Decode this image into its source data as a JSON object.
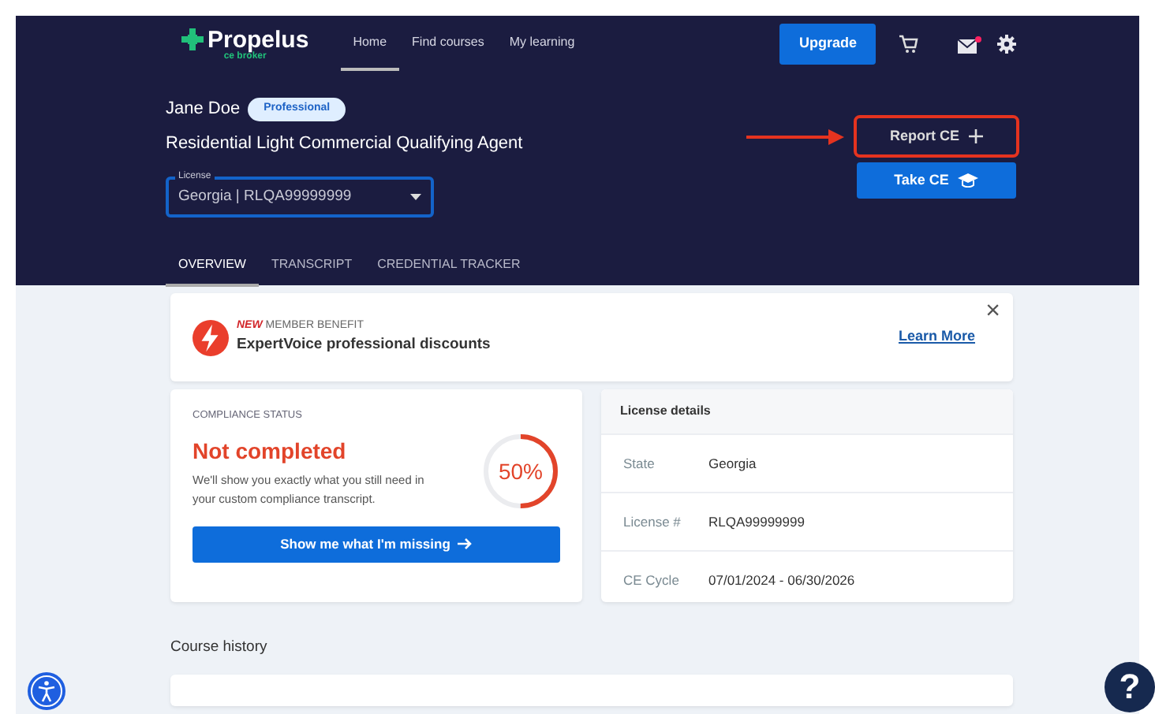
{
  "logo": {
    "name": "Propelus",
    "tagline": "ce broker"
  },
  "nav": [
    {
      "label": "Home",
      "selected": true
    },
    {
      "label": "Find courses",
      "selected": false
    },
    {
      "label": "My learning",
      "selected": false
    }
  ],
  "upgrade_button": "Upgrade",
  "mail_unread": true,
  "user": {
    "name": "Jane Doe",
    "badge": "Professional"
  },
  "profession": "Residential Light Commercial Qualifying Agent",
  "license_select": {
    "label": "License",
    "value": "Georgia | RLQA99999999"
  },
  "actions": [
    {
      "label": "Report CE",
      "kind": "report",
      "highlighted": true
    },
    {
      "label": "Take CE",
      "kind": "take",
      "highlighted": false
    }
  ],
  "tabs": [
    {
      "label": "OVERVIEW",
      "selected": true
    },
    {
      "label": "TRANSCRIPT",
      "selected": false
    },
    {
      "label": "CREDENTIAL TRACKER",
      "selected": false
    }
  ],
  "banner": {
    "tag": "NEW",
    "eyebrow": "MEMBER BENEFIT",
    "title": "ExpertVoice professional discounts",
    "link": "Learn More",
    "close": "×"
  },
  "compliance": {
    "heading": "COMPLIANCE STATUS",
    "status": "Not completed",
    "text": "We'll show you exactly what you still need in your custom compliance transcript.",
    "level": 0.5,
    "percent": "50%",
    "button": "Show me what I'm missing"
  },
  "license_details": {
    "heading": "License details",
    "rows": [
      {
        "label": "State",
        "value": "Georgia"
      },
      {
        "label": "License #",
        "value": "RLQA99999999"
      },
      {
        "label": "CE Cycle",
        "value": "07/01/2024 - 06/30/2026"
      }
    ]
  },
  "course_history": {
    "heading": "Course history"
  },
  "help_button": "?"
}
